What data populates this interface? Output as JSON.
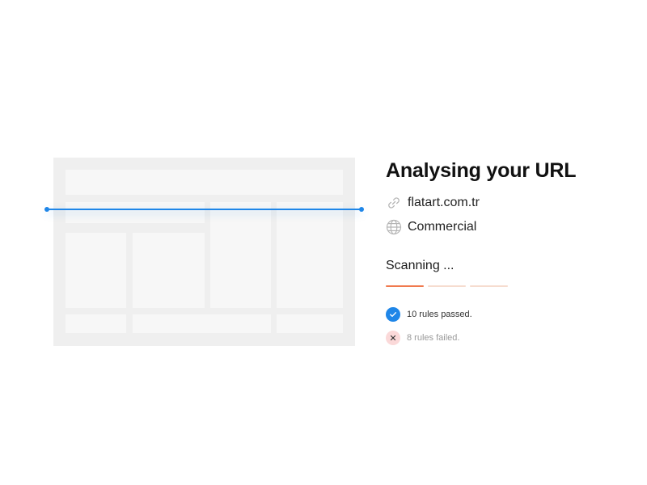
{
  "panel": {
    "title": "Analysing your URL",
    "url": {
      "icon": "link-icon",
      "text": "flatart.com.tr"
    },
    "category": {
      "icon": "globe-icon",
      "text": "Commercial"
    },
    "status": "Scanning ...",
    "progress_segments": [
      {
        "state": "active",
        "color": "#f07a4e"
      },
      {
        "state": "pending",
        "color": "#f6dccf"
      },
      {
        "state": "pending",
        "color": "#f6dccf"
      }
    ],
    "results": [
      {
        "icon": "check-icon",
        "text": "10 rules passed.",
        "badge_color": "#1f86e8",
        "text_color": "#333333"
      },
      {
        "icon": "close-icon",
        "text": "8 rules failed.",
        "badge_color": "#fbd9d9",
        "text_color": "#9a9a9a"
      }
    ]
  },
  "colors": {
    "accent": "#1f86e8",
    "scan_line": "#1f86e8",
    "preview_bg": "#efefef",
    "preview_block": "#f7f7f7"
  }
}
